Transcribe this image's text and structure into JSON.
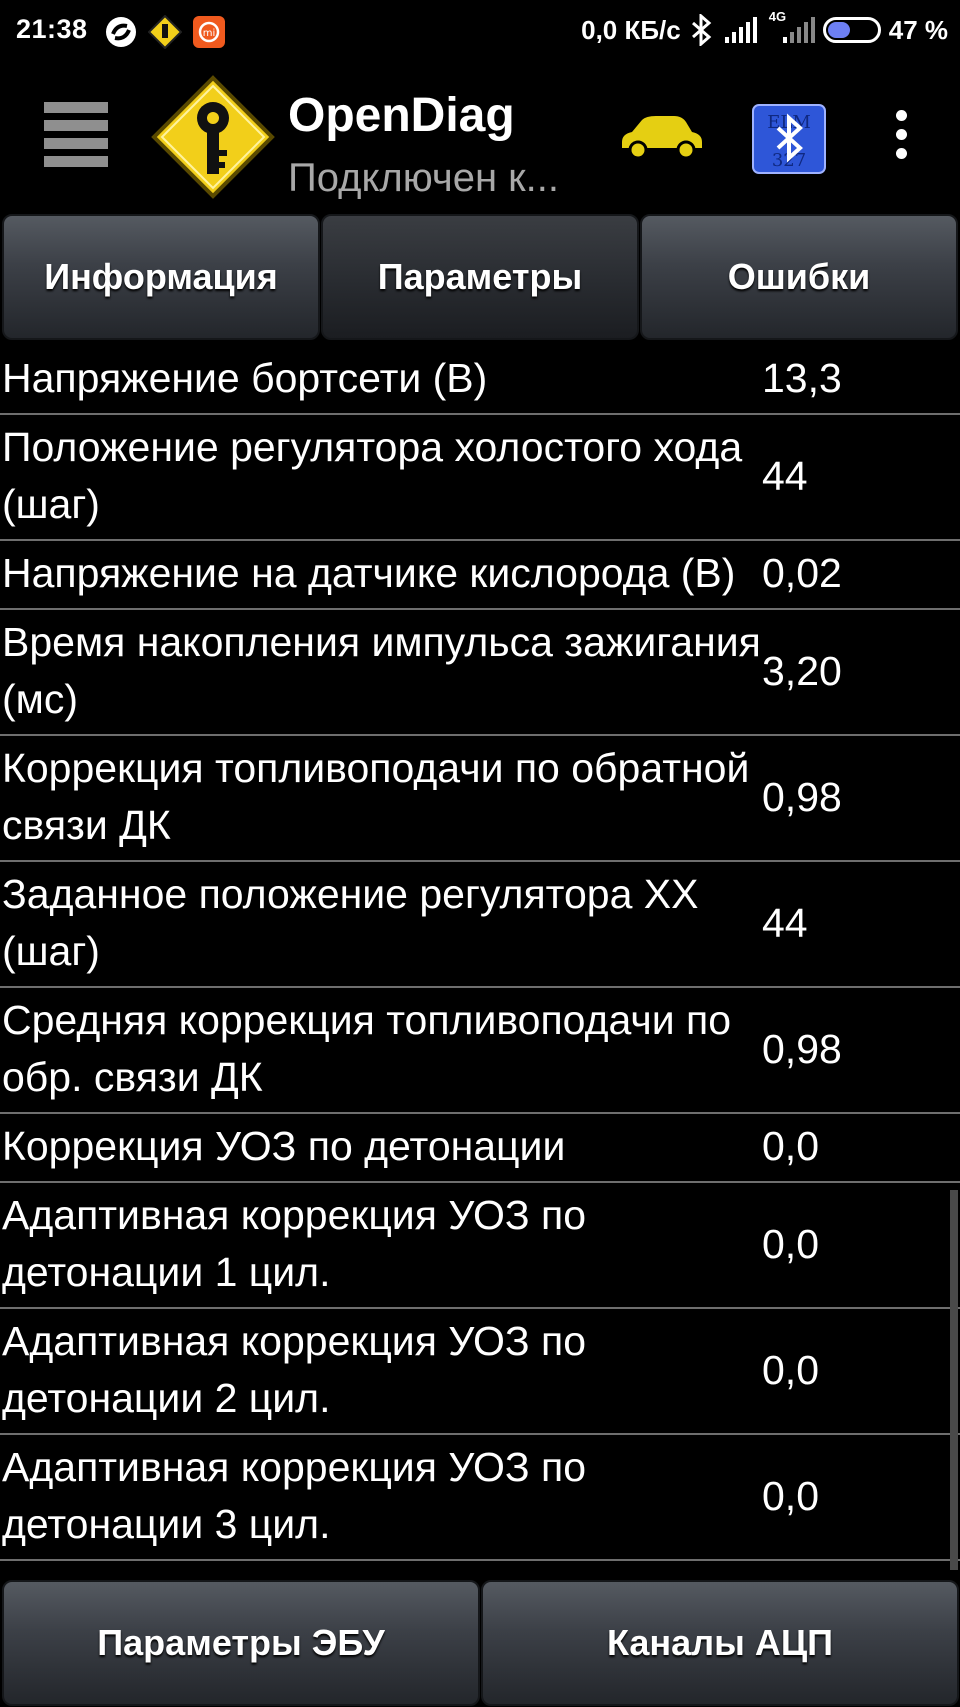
{
  "status_bar": {
    "time": "21:38",
    "network_speed": "0,0 КБ/с",
    "network_type": "4G",
    "battery_percent": "47 %",
    "battery_level": 0.47,
    "left_icons": [
      "sync-icon",
      "navigation-icon",
      "mi-icon"
    ],
    "right_icons": [
      "bluetooth-icon",
      "signal-icon",
      "signal-4g-icon",
      "battery-icon"
    ]
  },
  "action_bar": {
    "title": "OpenDiag",
    "subtitle": "Подключен к...",
    "icons": [
      "menu-icon",
      "app-logo-icon",
      "car-icon",
      "bluetooth-elm-icon",
      "overflow-menu-icon"
    ],
    "colors": {
      "car": "#e5cf12",
      "bluetooth_badge": "#2e56d8",
      "logo": "#f2cf1a"
    }
  },
  "tabs": [
    {
      "label": "Информация",
      "active": false
    },
    {
      "label": "Параметры",
      "active": true
    },
    {
      "label": "Ошибки",
      "active": false
    }
  ],
  "parameters": [
    {
      "name": "Напряжение бортсети (В)",
      "value": "13,3"
    },
    {
      "name": "Положение регулятора холостого хода (шаг)",
      "value": "44"
    },
    {
      "name": "Напряжение на датчике кислорода (В)",
      "value": "0,02"
    },
    {
      "name": "Время накопления импульса зажигания (мс)",
      "value": "3,20"
    },
    {
      "name": "Коррекция топливоподачи по обратной связи ДК",
      "value": "0,98"
    },
    {
      "name": "Заданное положение регулятора ХХ (шаг)",
      "value": "44"
    },
    {
      "name": "Средняя коррекция топливоподачи по обр. связи ДК",
      "value": "0,98"
    },
    {
      "name": "Коррекция УОЗ по детонации",
      "value": "0,0"
    },
    {
      "name": "Адаптивная коррекция УОЗ по детонации 1 цил.",
      "value": "0,0"
    },
    {
      "name": "Адаптивная коррекция УОЗ по детонации 2 цил.",
      "value": "0,0"
    },
    {
      "name": "Адаптивная коррекция УОЗ по детонации 3 цил.",
      "value": "0,0"
    }
  ],
  "bottom_buttons": [
    {
      "label": "Параметры ЭБУ"
    },
    {
      "label": "Каналы АЦП"
    }
  ]
}
